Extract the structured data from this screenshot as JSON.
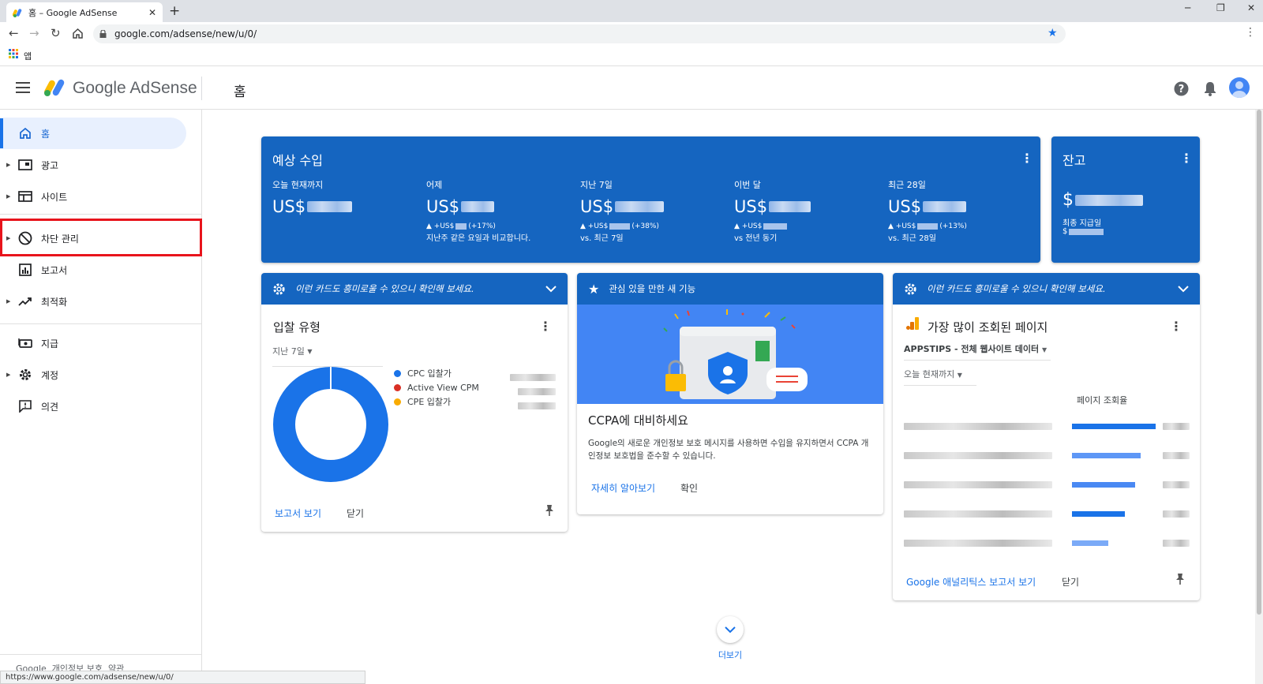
{
  "browser": {
    "tab_title": "홈 – Google AdSense",
    "new_tab": "+",
    "url": "google.com/adsense/new/u/0/",
    "apps_label": "앱",
    "status_url": "https://www.google.com/adsense/new/u/0/"
  },
  "header": {
    "logo_text": "Google AdSense",
    "page_title": "홈"
  },
  "sidebar": {
    "items": [
      {
        "label": "홈"
      },
      {
        "label": "광고"
      },
      {
        "label": "사이트"
      },
      {
        "label": "차단 관리"
      },
      {
        "label": "보고서"
      },
      {
        "label": "최적화"
      },
      {
        "label": "지급"
      },
      {
        "label": "계정"
      },
      {
        "label": "의견"
      }
    ],
    "footer_google": "Google",
    "footer_privacy": "개인정보 보호",
    "footer_terms": "약관"
  },
  "earnings": {
    "title": "예상 수입",
    "columns": [
      {
        "label": "오늘 현재까지",
        "prefix": "US$",
        "delta": "",
        "compare": ""
      },
      {
        "label": "어제",
        "prefix": "US$",
        "delta_prefix": "▲ +US$",
        "delta_pct": "(+17%)",
        "compare": "지난주 같은 요일과 비교합니다."
      },
      {
        "label": "지난 7일",
        "prefix": "US$",
        "delta_prefix": "▲ +US$",
        "delta_pct": "(+38%)",
        "compare": "vs. 최근 7일"
      },
      {
        "label": "이번 달",
        "prefix": "US$",
        "delta_prefix": "▲ +US$",
        "delta_pct": "",
        "compare": "vs 전년 동기"
      },
      {
        "label": "최근 28일",
        "prefix": "US$",
        "delta_prefix": "▲ +US$",
        "delta_pct": "(+13%)",
        "compare": "vs. 최근 28일"
      }
    ]
  },
  "balance": {
    "title": "잔고",
    "prefix": "$",
    "last_payment_label": "최종 지급일",
    "last_payment_prefix": "$"
  },
  "card_bid": {
    "banner": "이런 카드도 흥미로울 수 있으니 확인해 보세요.",
    "title": "입찰 유형",
    "range": "지난 7일",
    "legend": [
      {
        "name": "CPC 입찰가",
        "color": "#1a73e8"
      },
      {
        "name": "Active View CPM",
        "color": "#d93025"
      },
      {
        "name": "CPE 입찰가",
        "color": "#f9ab00"
      }
    ],
    "view_report": "보고서 보기",
    "close": "닫기"
  },
  "card_ccpa": {
    "banner": "관심 있을 만한 새 기능",
    "title": "CCPA에 대비하세요",
    "body": "Google의 새로운 개인정보 보호 메시지를 사용하면 수입을 유지하면서 CCPA 개인정보 보호법을 준수할 수 있습니다.",
    "learn_more": "자세히 알아보기",
    "ok": "확인"
  },
  "card_pages": {
    "banner": "이런 카드도 흥미로울 수 있으니 확인해 보세요.",
    "title": "가장 많이 조회된 페이지",
    "property": "APPSTIPS - 전체 웹사이트 데이터",
    "range": "오늘 현재까지",
    "col_header": "페이지 조회율",
    "bars": [
      0.76,
      0.62,
      0.57,
      0.48,
      0.33
    ],
    "view_report": "Google 애널리틱스 보고서 보기",
    "close": "닫기"
  },
  "more": {
    "label": "더보기"
  },
  "colors": {
    "primary": "#1565c0",
    "accent": "#1a73e8",
    "highlight": "#e8141c"
  }
}
